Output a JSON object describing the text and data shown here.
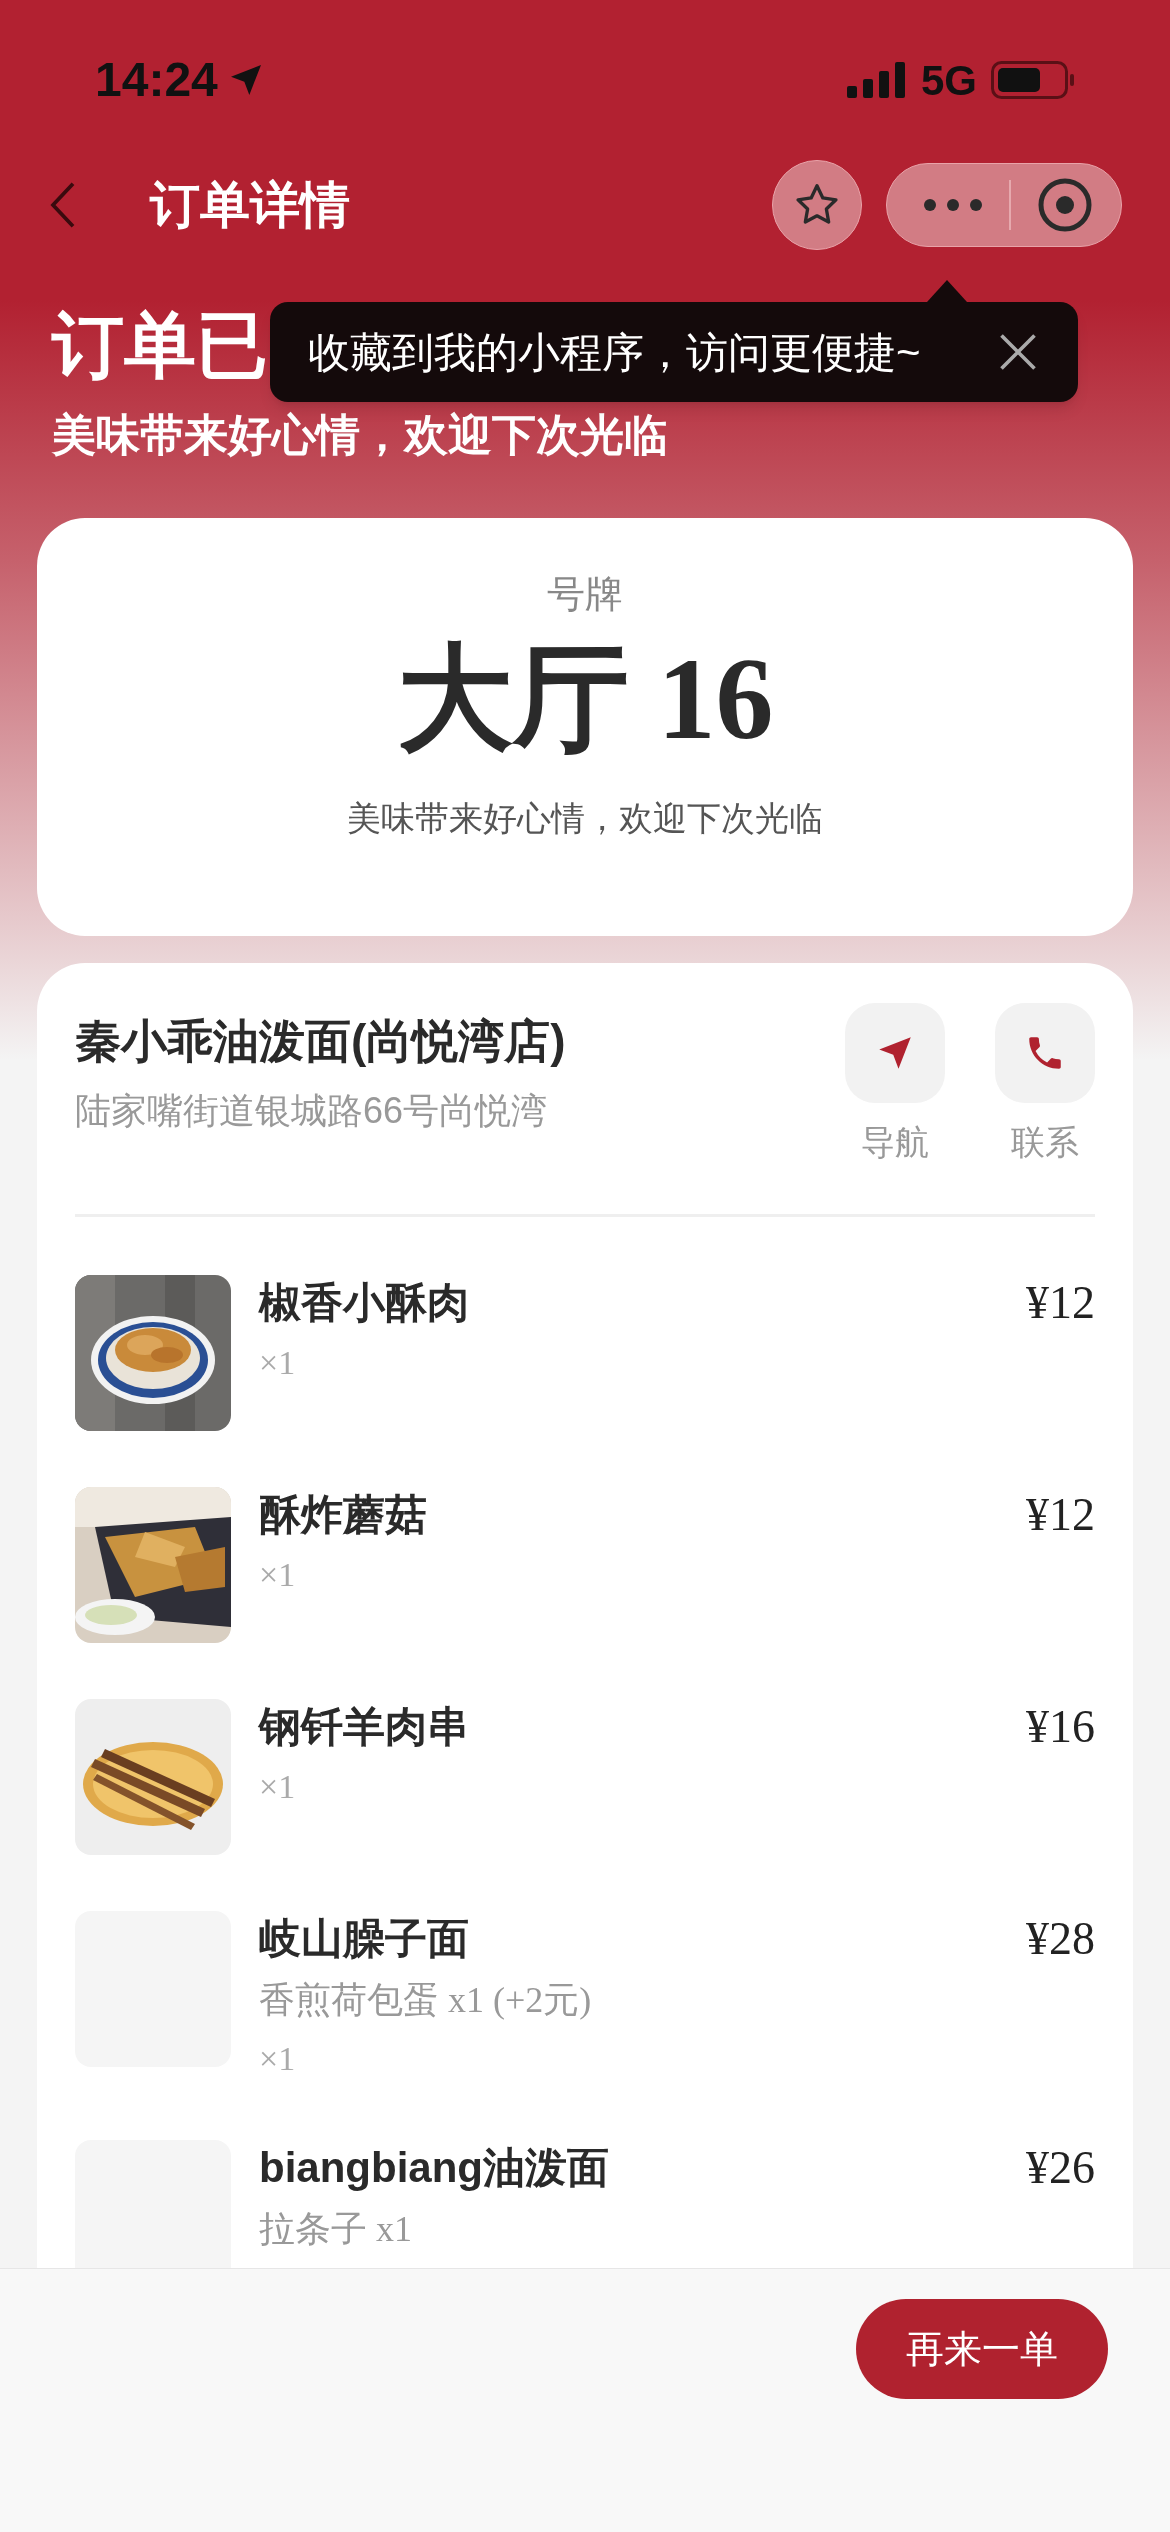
{
  "status_bar": {
    "time": "14:24",
    "network": "5G"
  },
  "nav": {
    "title": "订单详情"
  },
  "tooltip": {
    "text": "收藏到我的小程序，访问更便捷~"
  },
  "header": {
    "title": "订单已",
    "subtitle": "美味带来好心情，欢迎下次光临"
  },
  "ticket": {
    "label": "号牌",
    "number": "大厅 16",
    "message": "美味带来好心情，欢迎下次光临"
  },
  "store": {
    "name": "秦小乖油泼面(尚悦湾店)",
    "address": "陆家嘴街道银城路66号尚悦湾",
    "actions": [
      {
        "kind": "navigate",
        "label": "导航"
      },
      {
        "kind": "call",
        "label": "联系"
      }
    ]
  },
  "items": [
    {
      "kind": "picture",
      "name": "椒香小酥肉",
      "qty": "×1",
      "price": "¥12"
    },
    {
      "kind": "picture",
      "name": "酥炸蘑菇",
      "qty": "×1",
      "price": "¥12"
    },
    {
      "kind": "picture",
      "name": "钢钎羊肉串",
      "qty": "×1",
      "price": "¥16"
    },
    {
      "kind": "placeholder",
      "name": "岐山臊子面",
      "options": "香煎荷包蛋 x1 (+2元)",
      "qty": "×1",
      "price": "¥28"
    },
    {
      "kind": "placeholder",
      "name": "biangbiang油泼面",
      "options": "拉条子 x1",
      "price": "¥26"
    }
  ],
  "footer": {
    "button": "再来一单"
  }
}
